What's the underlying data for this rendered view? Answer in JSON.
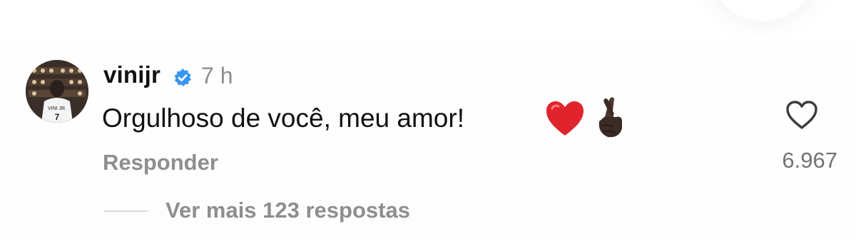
{
  "comment": {
    "username": "vinijr",
    "verified_icon": "verified-badge-icon",
    "timestamp": "7 h",
    "text": "Orgulhoso de você, meu amor!",
    "emojis": [
      "red-heart-emoji",
      "crossed-fingers-emoji"
    ],
    "reply_label": "Responder",
    "like_icon": "heart-outline-icon",
    "like_count": "6.967",
    "view_more_label": "Ver mais 123 respostas",
    "avatar_text": "VINI JR.",
    "avatar_number": "7"
  },
  "colors": {
    "verified_blue": "#3897f0",
    "text_primary": "#111111",
    "text_secondary": "#8e8e8e",
    "emoji_heart": "#e0242d",
    "emoji_skin": "#3b2b25"
  }
}
